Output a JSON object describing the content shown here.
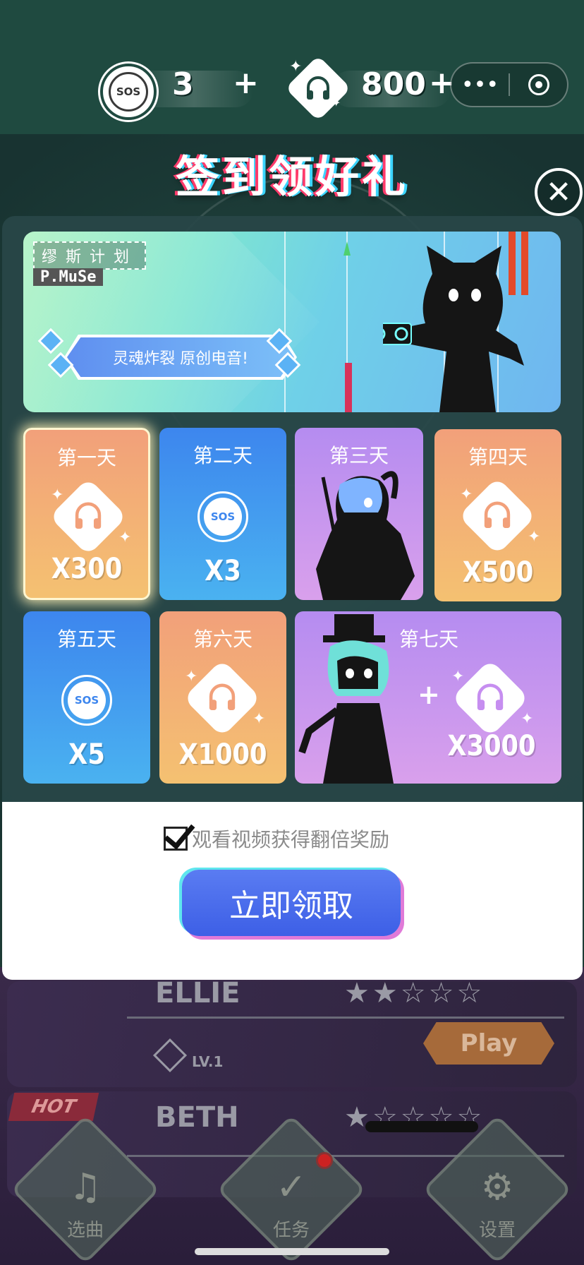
{
  "top_bar": {
    "sos_icon": "sos-icon",
    "sos_label": "SOS",
    "sos_count": "3",
    "sos_add": "+",
    "headphone_icon": "headphone-icon",
    "coin_count": "800",
    "coin_add": "+",
    "more_label": "•••"
  },
  "popup": {
    "title": "签到领好礼",
    "close_label": "✕",
    "banner": {
      "brand_cn": "缪斯计划",
      "brand_en": "P.MuSe",
      "slogan": "灵魂炸裂 原创电音!"
    },
    "days": [
      {
        "label": "第一天",
        "reward_type": "headphone",
        "amount": "X300",
        "color": "orange"
      },
      {
        "label": "第二天",
        "reward_type": "sos",
        "reward_label": "SOS",
        "amount": "X3",
        "color": "blue"
      },
      {
        "label": "第三天",
        "reward_type": "character",
        "amount": "",
        "color": "purple"
      },
      {
        "label": "第四天",
        "reward_type": "headphone",
        "amount": "X500",
        "color": "orange"
      },
      {
        "label": "第五天",
        "reward_type": "sos",
        "reward_label": "SOS",
        "amount": "X5",
        "color": "blue"
      },
      {
        "label": "第六天",
        "reward_type": "headphone",
        "amount": "X1000",
        "color": "orange"
      },
      {
        "label": "第七天",
        "reward_type": "character+headphone",
        "plus": "+",
        "amount": "X3000",
        "color": "purple"
      }
    ],
    "double_reward_checked": true,
    "double_reward_label": "观看视频获得翻倍奖励",
    "claim_button": "立即领取"
  },
  "background": {
    "songs": [
      {
        "name": "ELLIE",
        "stars": "★★☆☆☆",
        "level": "LV.1",
        "play": "Play"
      },
      {
        "name": "BETH",
        "stars": "★☆☆☆☆",
        "level": "",
        "play": ""
      }
    ],
    "hot_tag": "HOT",
    "nav": [
      {
        "label": "选曲",
        "icon": "music-note-icon",
        "glyph": "♫"
      },
      {
        "label": "任务",
        "icon": "clipboard-check-icon",
        "glyph": "✓"
      },
      {
        "label": "设置",
        "icon": "gear-icon",
        "glyph": "⚙"
      }
    ]
  },
  "colors": {
    "orange_card": "#f2a07a",
    "blue_card": "#3d86ee",
    "purple_card": "#b58cf0",
    "claim_button": "#4a6cec",
    "bg_green": "#1f4a40"
  }
}
